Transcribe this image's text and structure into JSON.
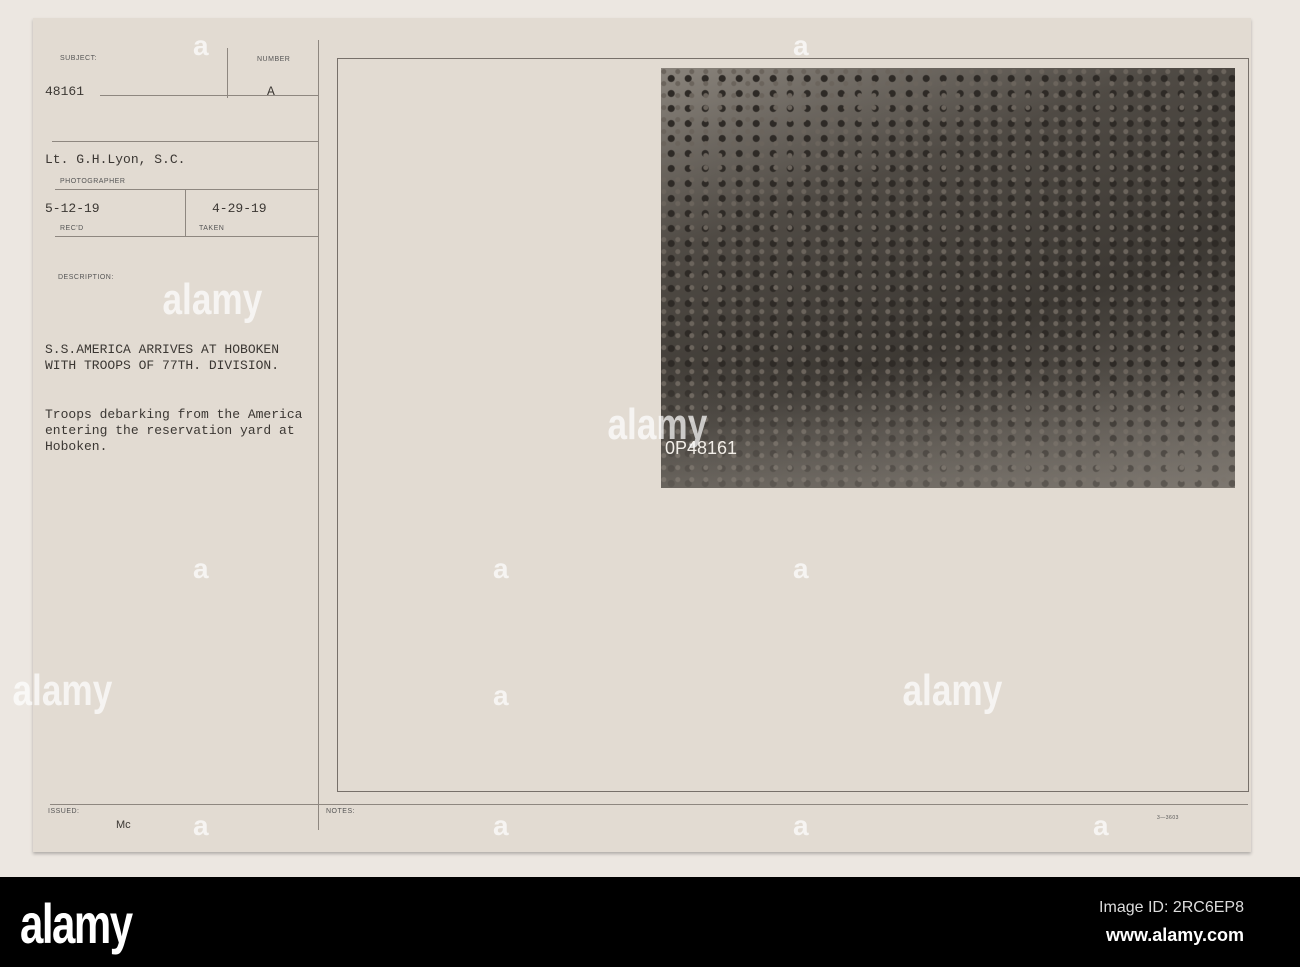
{
  "card": {
    "subject_label": "SUBJECT:",
    "subject_value": "48161",
    "number_label": "NUMBER",
    "number_value": "A",
    "photographer_value": "Lt. G.H.Lyon, S.C.",
    "photographer_label": "PHOTOGRAPHER",
    "received_value": "5-12-19",
    "received_label": "REC'D",
    "taken_value": "4-29-19",
    "taken_label": "TAKEN",
    "description_label": "DESCRIPTION:",
    "title_line1": "S.S.AMERICA ARRIVES AT HOBOKEN",
    "title_line2": "WITH TROOPS OF 77TH. DIVISION.",
    "desc_line1": "Troops debarking from the America",
    "desc_line2": "entering the reservation yard at",
    "desc_line3": "Hoboken.",
    "issued_label": "ISSUED:",
    "issued_value": "Mc",
    "notes_label": "NOTES:",
    "form_number": "3—3603"
  },
  "photo": {
    "negative_number": "0P48161"
  },
  "watermark": {
    "text": "alamy",
    "mark": "a"
  },
  "footer": {
    "logo": "alamy",
    "image_id": "Image ID: 2RC6EP8",
    "url": "www.alamy.com"
  }
}
